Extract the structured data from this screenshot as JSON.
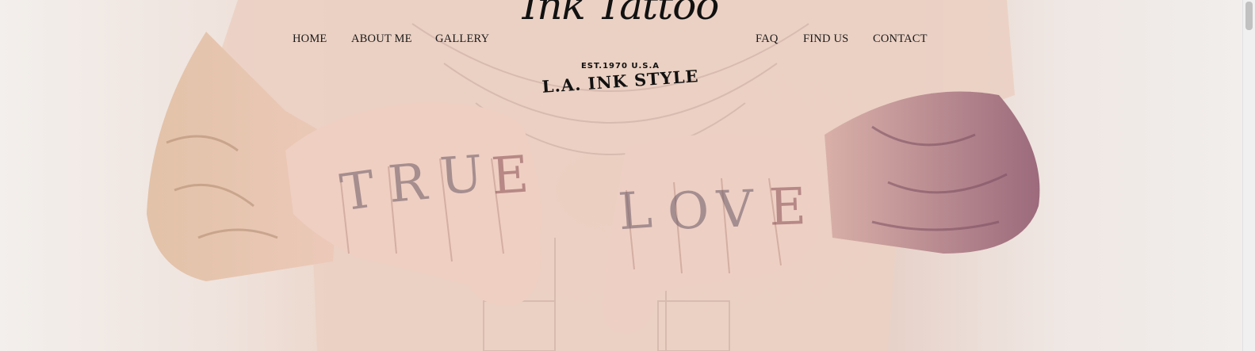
{
  "nav": {
    "left": [
      {
        "label": "HOME"
      },
      {
        "label": "ABOUT ME"
      },
      {
        "label": "GALLERY"
      }
    ],
    "right": [
      {
        "label": "FAQ"
      },
      {
        "label": "FIND US"
      },
      {
        "label": "CONTACT"
      }
    ]
  },
  "logo": {
    "script": "Ink Tattoo",
    "est": "EST.1970 U.S.A",
    "tagline": "L.A. INK STYLE"
  },
  "hero": {
    "left_knuckles": [
      "T",
      "R",
      "U",
      "E"
    ],
    "right_knuckles": [
      "L",
      "O",
      "V",
      "E"
    ]
  },
  "colors": {
    "nav_text": "#1a1a1a",
    "background": "#f1ece9",
    "skin": "#e8c7b8",
    "tattoo_ink": "#6b5a66"
  }
}
